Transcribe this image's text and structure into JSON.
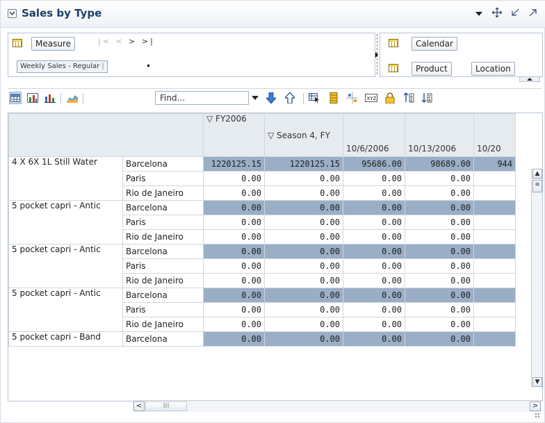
{
  "title": "Sales by Type",
  "layout": {
    "rows_chip": "Measure",
    "measure_member": "Weekly Sales - Regular",
    "member_sep": "|",
    "col_chips": [
      "Calendar",
      "Product",
      "Location"
    ]
  },
  "toolbar": {
    "find_placeholder": "Find..."
  },
  "table": {
    "col_headers": {
      "fy": "FY2006",
      "season": "Season 4, FY",
      "weeks": [
        "10/6/2006",
        "10/13/2006",
        "10/20"
      ]
    },
    "rows": [
      {
        "product": "4 X 6X 1L Still Water",
        "location": "Barcelona",
        "values": [
          "1220125.15",
          "1220125.15",
          "95686.00",
          "98689.00",
          "944"
        ],
        "hl": true
      },
      {
        "product": "",
        "location": "Paris",
        "values": [
          "0.00",
          "0.00",
          "0.00",
          "0.00",
          ""
        ],
        "hl": false
      },
      {
        "product": "",
        "location": "Rio de Janeiro",
        "values": [
          "0.00",
          "0.00",
          "0.00",
          "0.00",
          ""
        ],
        "hl": false
      },
      {
        "product": "5 pocket capri - Antic",
        "location": "Barcelona",
        "values": [
          "0.00",
          "0.00",
          "0.00",
          "0.00",
          ""
        ],
        "hl": true
      },
      {
        "product": "",
        "location": "Paris",
        "values": [
          "0.00",
          "0.00",
          "0.00",
          "0.00",
          ""
        ],
        "hl": false
      },
      {
        "product": "",
        "location": "Rio de Janeiro",
        "values": [
          "0.00",
          "0.00",
          "0.00",
          "0.00",
          ""
        ],
        "hl": false
      },
      {
        "product": "5 pocket capri - Antic",
        "location": "Barcelona",
        "values": [
          "0.00",
          "0.00",
          "0.00",
          "0.00",
          ""
        ],
        "hl": true
      },
      {
        "product": "",
        "location": "Paris",
        "values": [
          "0.00",
          "0.00",
          "0.00",
          "0.00",
          ""
        ],
        "hl": false
      },
      {
        "product": "",
        "location": "Rio de Janeiro",
        "values": [
          "0.00",
          "0.00",
          "0.00",
          "0.00",
          ""
        ],
        "hl": false
      },
      {
        "product": "5 pocket capri - Antic",
        "location": "Barcelona",
        "values": [
          "0.00",
          "0.00",
          "0.00",
          "0.00",
          ""
        ],
        "hl": true
      },
      {
        "product": "",
        "location": "Paris",
        "values": [
          "0.00",
          "0.00",
          "0.00",
          "0.00",
          ""
        ],
        "hl": false
      },
      {
        "product": "",
        "location": "Rio de Janeiro",
        "values": [
          "0.00",
          "0.00",
          "0.00",
          "0.00",
          ""
        ],
        "hl": false
      },
      {
        "product": "5 pocket capri - Band",
        "location": "Barcelona",
        "values": [
          "0.00",
          "0.00",
          "0.00",
          "0.00",
          ""
        ],
        "hl": true
      }
    ]
  },
  "colors": {
    "title": "#1f3f68",
    "highlight_row": "#9aaec6",
    "header_bg": "#e6ebf0"
  },
  "icons": [
    "collapse-icon",
    "dropdown-icon",
    "move-icon",
    "minimize-icon",
    "maximize-icon"
  ]
}
